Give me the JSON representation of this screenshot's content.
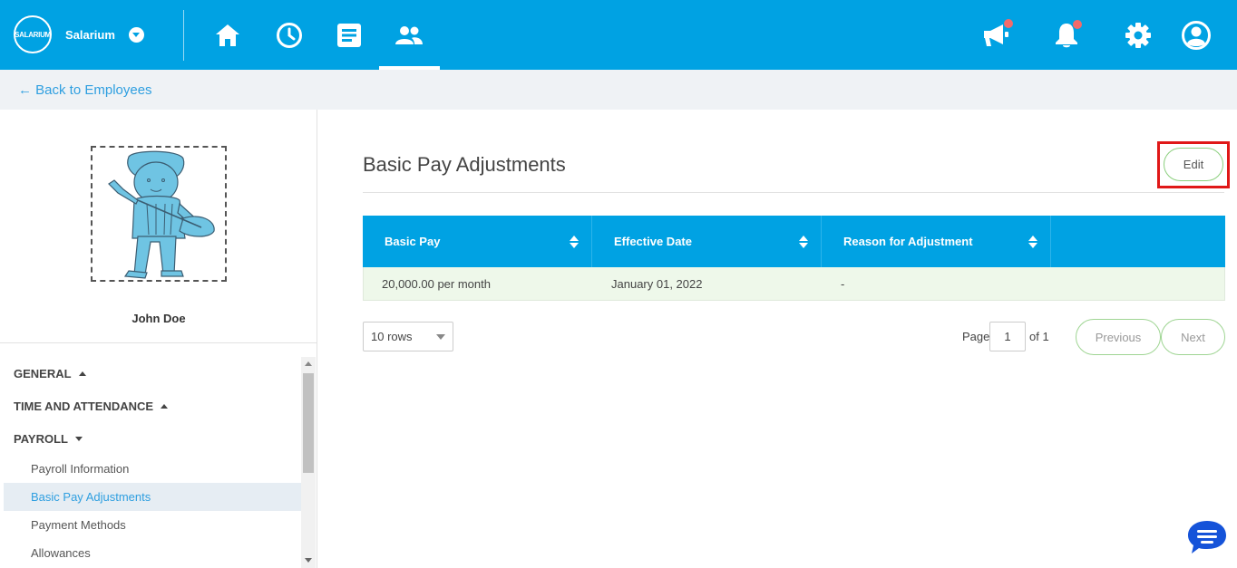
{
  "app": {
    "brand_name": "Salarium",
    "logo_text": "SALARIUM"
  },
  "nav": {
    "icons": [
      "home-icon",
      "clock-icon",
      "document-icon",
      "people-icon"
    ],
    "active": "people-icon",
    "right_icons": [
      "megaphone-icon",
      "bell-icon",
      "gear-icon",
      "user-icon"
    ]
  },
  "subheader": {
    "back_label": "← Back to Employees"
  },
  "employee": {
    "name": "John Doe"
  },
  "sidebar": {
    "sections": [
      {
        "label": "GENERAL",
        "expanded": false
      },
      {
        "label": "TIME AND ATTENDANCE",
        "expanded": false
      },
      {
        "label": "PAYROLL",
        "expanded": true
      }
    ],
    "payroll_items": [
      "Payroll Information",
      "Basic Pay Adjustments",
      "Payment Methods",
      "Allowances"
    ],
    "active_item": "Basic Pay Adjustments"
  },
  "main": {
    "title": "Basic Pay Adjustments",
    "edit_label": "Edit",
    "table": {
      "headers": [
        "Basic Pay",
        "Effective Date",
        "Reason for Adjustment"
      ],
      "rows": [
        [
          "20,000.00 per month",
          "January 01, 2022",
          "-"
        ]
      ]
    },
    "pagination": {
      "rows_label": "10 rows",
      "page_label": "Page",
      "page_value": "1",
      "of_label": "of 1",
      "previous_label": "Previous",
      "next_label": "Next"
    }
  },
  "colors": {
    "primary": "#00a2e3",
    "link": "#2f9fe0",
    "alert": "#f26b6b",
    "highlight": "#e01818",
    "row_bg": "#eef8ea"
  }
}
